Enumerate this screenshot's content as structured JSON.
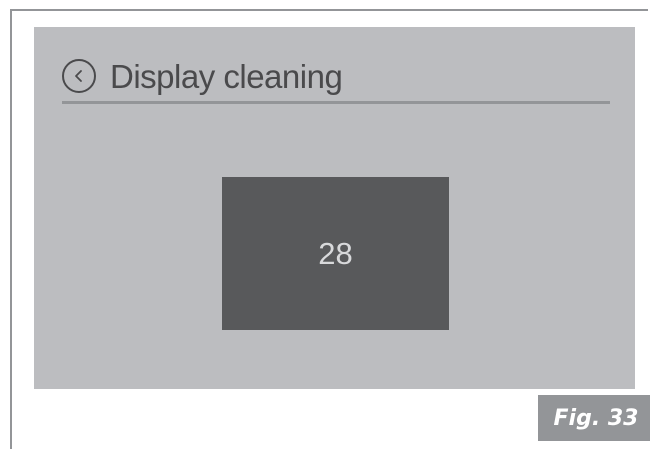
{
  "screen": {
    "title": "Display cleaning",
    "back_icon": "chevron-left-circle-icon",
    "counter_value": "28"
  },
  "figure": {
    "label": "Fig. 33"
  },
  "colors": {
    "screen_bg": "#bcbdc0",
    "counter_bg": "#58595b",
    "text_dark": "#4a4a4c",
    "frame_gray": "#939598"
  }
}
